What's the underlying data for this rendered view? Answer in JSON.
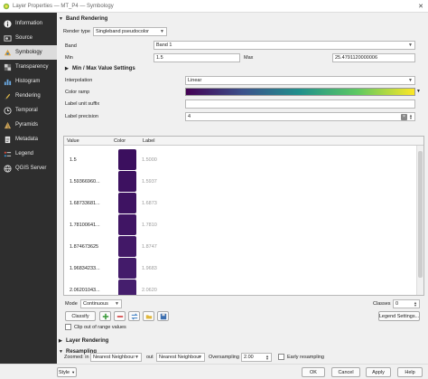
{
  "window": {
    "title": "Layer Properties — MT_P4 — Symbology"
  },
  "sidebar": {
    "items": [
      {
        "label": "Information",
        "icon": "info-icon"
      },
      {
        "label": "Source",
        "icon": "source-icon"
      },
      {
        "label": "Symbology",
        "icon": "symbology-icon"
      },
      {
        "label": "Transparency",
        "icon": "transparency-icon"
      },
      {
        "label": "Histogram",
        "icon": "histogram-icon"
      },
      {
        "label": "Rendering",
        "icon": "rendering-icon"
      },
      {
        "label": "Temporal",
        "icon": "temporal-icon"
      },
      {
        "label": "Pyramids",
        "icon": "pyramids-icon"
      },
      {
        "label": "Metadata",
        "icon": "metadata-icon"
      },
      {
        "label": "Legend",
        "icon": "legend-icon"
      },
      {
        "label": "QGIS Server",
        "icon": "qgis-server-icon"
      }
    ],
    "active_index": 2
  },
  "band_rendering": {
    "header": "Band Rendering",
    "render_type_label": "Render type",
    "render_type_value": "Singleband pseudocolor",
    "band_label": "Band",
    "band_value": "Band 1",
    "min_label": "Min",
    "min_value": "1.5",
    "max_label": "Max",
    "max_value": "25.4791120000006",
    "minmax_header": "Min / Max Value Settings",
    "interpolation_label": "Interpolation",
    "interpolation_value": "Linear",
    "color_ramp_label": "Color ramp",
    "label_unit_suffix_label": "Label unit suffix",
    "label_unit_suffix_value": "",
    "label_precision_label": "Label precision",
    "label_precision_value": "4"
  },
  "table": {
    "columns": [
      "Value",
      "Color",
      "Label"
    ],
    "rows": [
      {
        "value": "1.5",
        "label": "1.5000",
        "color": "#3b0f5e"
      },
      {
        "value": "1.59366960...",
        "label": "1.5937",
        "color": "#3d1160"
      },
      {
        "value": "1.68733681...",
        "label": "1.6873",
        "color": "#3e1362"
      },
      {
        "value": "1.78100641...",
        "label": "1.7810",
        "color": "#401564"
      },
      {
        "value": "1.874673625",
        "label": "1.8747",
        "color": "#421867"
      },
      {
        "value": "1.96834233...",
        "label": "1.9683",
        "color": "#431b6a"
      },
      {
        "value": "2.06201043...",
        "label": "2.0620",
        "color": "#451e6d"
      }
    ]
  },
  "mode": {
    "label": "Mode",
    "value": "Continuous",
    "classes_label": "Classes",
    "classes_value": "0"
  },
  "buttons": {
    "classify": "Classify",
    "legend_settings": "Legend Settings...",
    "style": "Style",
    "ok": "OK",
    "cancel": "Cancel",
    "apply": "Apply",
    "help": "Help"
  },
  "clip_label": "Clip out of range values",
  "layer_rendering_header": "Layer Rendering",
  "resampling": {
    "header": "Resampling",
    "zoomed_in_label": "Zoomed: in",
    "zoomed_in_value": "Nearest Neighbour",
    "out_label": "out",
    "out_value": "Nearest Neighbour",
    "oversampling_label": "Oversampling",
    "oversampling_value": "2.00",
    "early_resampling_label": "Early resampling"
  },
  "colors": {
    "sidebar_bg": "#2e2e2e",
    "accent": "#3b0f5e"
  }
}
